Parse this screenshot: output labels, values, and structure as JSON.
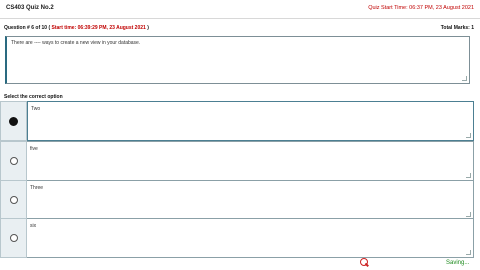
{
  "header": {
    "title": "CS403 Quiz No.2",
    "start_time": "Quiz Start Time: 06:37 PM, 23 August 2021"
  },
  "question": {
    "number": "Question # 6 of 10 (",
    "start_time": "Start time: 06:39:29 PM, 23 August 2021",
    "close": ")",
    "total_marks": "Total Marks: 1",
    "text": "There are ---- ways to create a new view in your database."
  },
  "select_label": "Select the correct option",
  "options": [
    {
      "text": "Two",
      "selected": true
    },
    {
      "text": "five",
      "selected": false
    },
    {
      "text": "Three",
      "selected": false
    },
    {
      "text": "six",
      "selected": false
    }
  ],
  "footer": {
    "saving": "Saving...",
    "icon": "search-icon",
    "accent": "#1c8a1c"
  }
}
